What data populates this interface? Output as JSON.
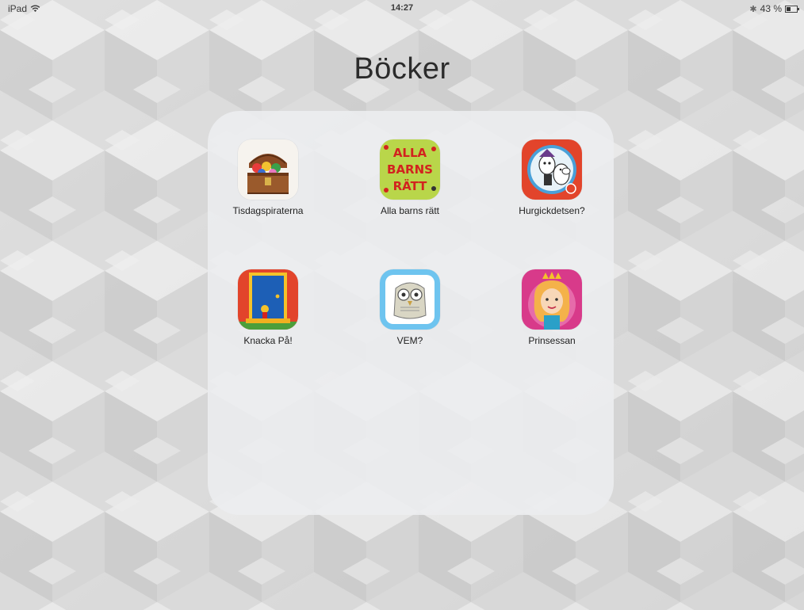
{
  "status_bar": {
    "device": "iPad",
    "time": "14:27",
    "bluetooth": "✱",
    "battery": "43 %",
    "battery_level": 0.43,
    "icons": [
      "wifi-icon",
      "bluetooth-icon",
      "battery-icon"
    ]
  },
  "folder": {
    "title": "Böcker",
    "apps": [
      {
        "label": "Tisdagspiraterna",
        "icon": "treasure-chest-icon"
      },
      {
        "label": "Alla barns rätt",
        "icon": "alla-barns-ratt-icon",
        "icon_text": [
          "ALLA",
          "BARNS",
          "RÄTT"
        ]
      },
      {
        "label": "Hurgickdetsen?",
        "icon": "moomin-icon"
      },
      {
        "label": "Knacka På!",
        "icon": "blue-door-icon"
      },
      {
        "label": "VEM?",
        "icon": "owl-icon"
      },
      {
        "label": "Prinsessan",
        "icon": "princess-icon"
      }
    ]
  },
  "colors": {
    "wallpaper": "#d0d0d0",
    "folder_bg": "#ecedef",
    "alla_barns_bg": "#b9d64a",
    "alla_barns_text": "#d2231f",
    "moomin_ring": "#e2442b",
    "door_blue": "#1d5fb6",
    "owl_frame": "#6ec4ef",
    "princess_pink": "#d83a8a"
  }
}
